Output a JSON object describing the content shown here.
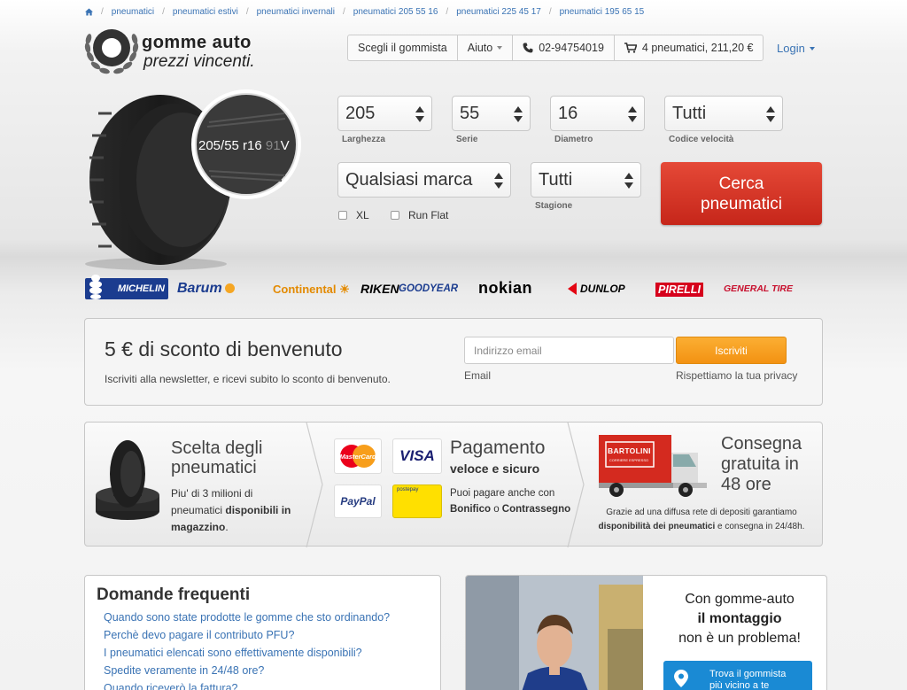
{
  "breadcrumb": [
    "pneumatici",
    "pneumatici estivi",
    "pneumatici invernali",
    "pneumatici 205 55 16",
    "pneumatici 225 45 17",
    "pneumatici 195 65 15"
  ],
  "logo": {
    "line1": "gomme auto",
    "line2": "prezzi vincenti."
  },
  "topnav": {
    "gommista": "Scegli il gommista",
    "aiuto": "Aiuto",
    "phone": "02-94754019",
    "cart": "4 pneumatici, 211,20 €"
  },
  "login": "Login",
  "tire_label": "205/55 r16 91V",
  "tire_label_main": "205/55 r16",
  "tire_label_dim": "91",
  "tire_label_tail": "V",
  "search": {
    "larghezza": {
      "value": "205",
      "label": "Larghezza"
    },
    "serie": {
      "value": "55",
      "label": "Serie"
    },
    "diametro": {
      "value": "16",
      "label": "Diametro"
    },
    "velocita": {
      "value": "Tutti",
      "label": "Codice velocità"
    },
    "marca": {
      "value": "Qualsiasi marca"
    },
    "stagione": {
      "value": "Tutti",
      "label": "Stagione"
    },
    "xl": "XL",
    "runflat": "Run Flat",
    "button": "Cerca pneumatici"
  },
  "brands": [
    "MICHELIN",
    "Barum",
    "Continental",
    "RIKEN",
    "GOODYEAR",
    "nokian",
    "DUNLOP",
    "PIRELLI",
    "GENERAL TIRE"
  ],
  "newsletter": {
    "title": "5 € di sconto di benvenuto",
    "subtitle": "Iscriviti alla newsletter, e ricevi subito lo sconto di benvenuto.",
    "placeholder": "Indirizzo email",
    "button": "Iscriviti",
    "email_label": "Email",
    "privacy": "Rispettiamo la tua privacy"
  },
  "features": {
    "f1": {
      "title": "Scelta degli pneumatici",
      "text1": "Piu' di 3 milioni di",
      "text2a": "pneumatici ",
      "text2b": "disponibili in",
      "text3": "magazzino",
      "text3b": "."
    },
    "f2": {
      "title": "Pagamento",
      "title2": "veloce e sicuro",
      "text1": "Puoi pagare anche con",
      "bonifico": "Bonifico",
      "o": " o ",
      "contrassegno": "Contrassegno",
      "cards": [
        "MasterCard",
        "VISA",
        "PayPal",
        "postepay"
      ]
    },
    "f3": {
      "title": "Consegna gratuita in 48 ore",
      "text1": "Grazie ad una diffusa rete di depositi garantiamo",
      "text2a": "disponibilità dei pneumatici",
      "text2b": " e consegna in 24/48h.",
      "truck": "BARTOLINI",
      "truck_sub": "CORRIERE ESPRESSO"
    }
  },
  "faq": {
    "title": "Domande frequenti",
    "items": [
      "Quando sono state prodotte le gomme che sto ordinando?",
      "Perchè devo pagare il contributo PFU?",
      "I pneumatici elencati sono effettivamente disponibili?",
      "Spedite veramente in 24/48 ore?",
      "Quando riceverò la fattura?"
    ]
  },
  "montaggio": {
    "line1": "Con gomme-auto",
    "line2": "il montaggio",
    "line3": "non è un problema!",
    "button": "Trova il gommista più vicino a te"
  },
  "colors": {
    "link": "#3a73b4",
    "cta": "#d8362a",
    "orange": "#f6a023",
    "blue": "#1a8ad4"
  }
}
